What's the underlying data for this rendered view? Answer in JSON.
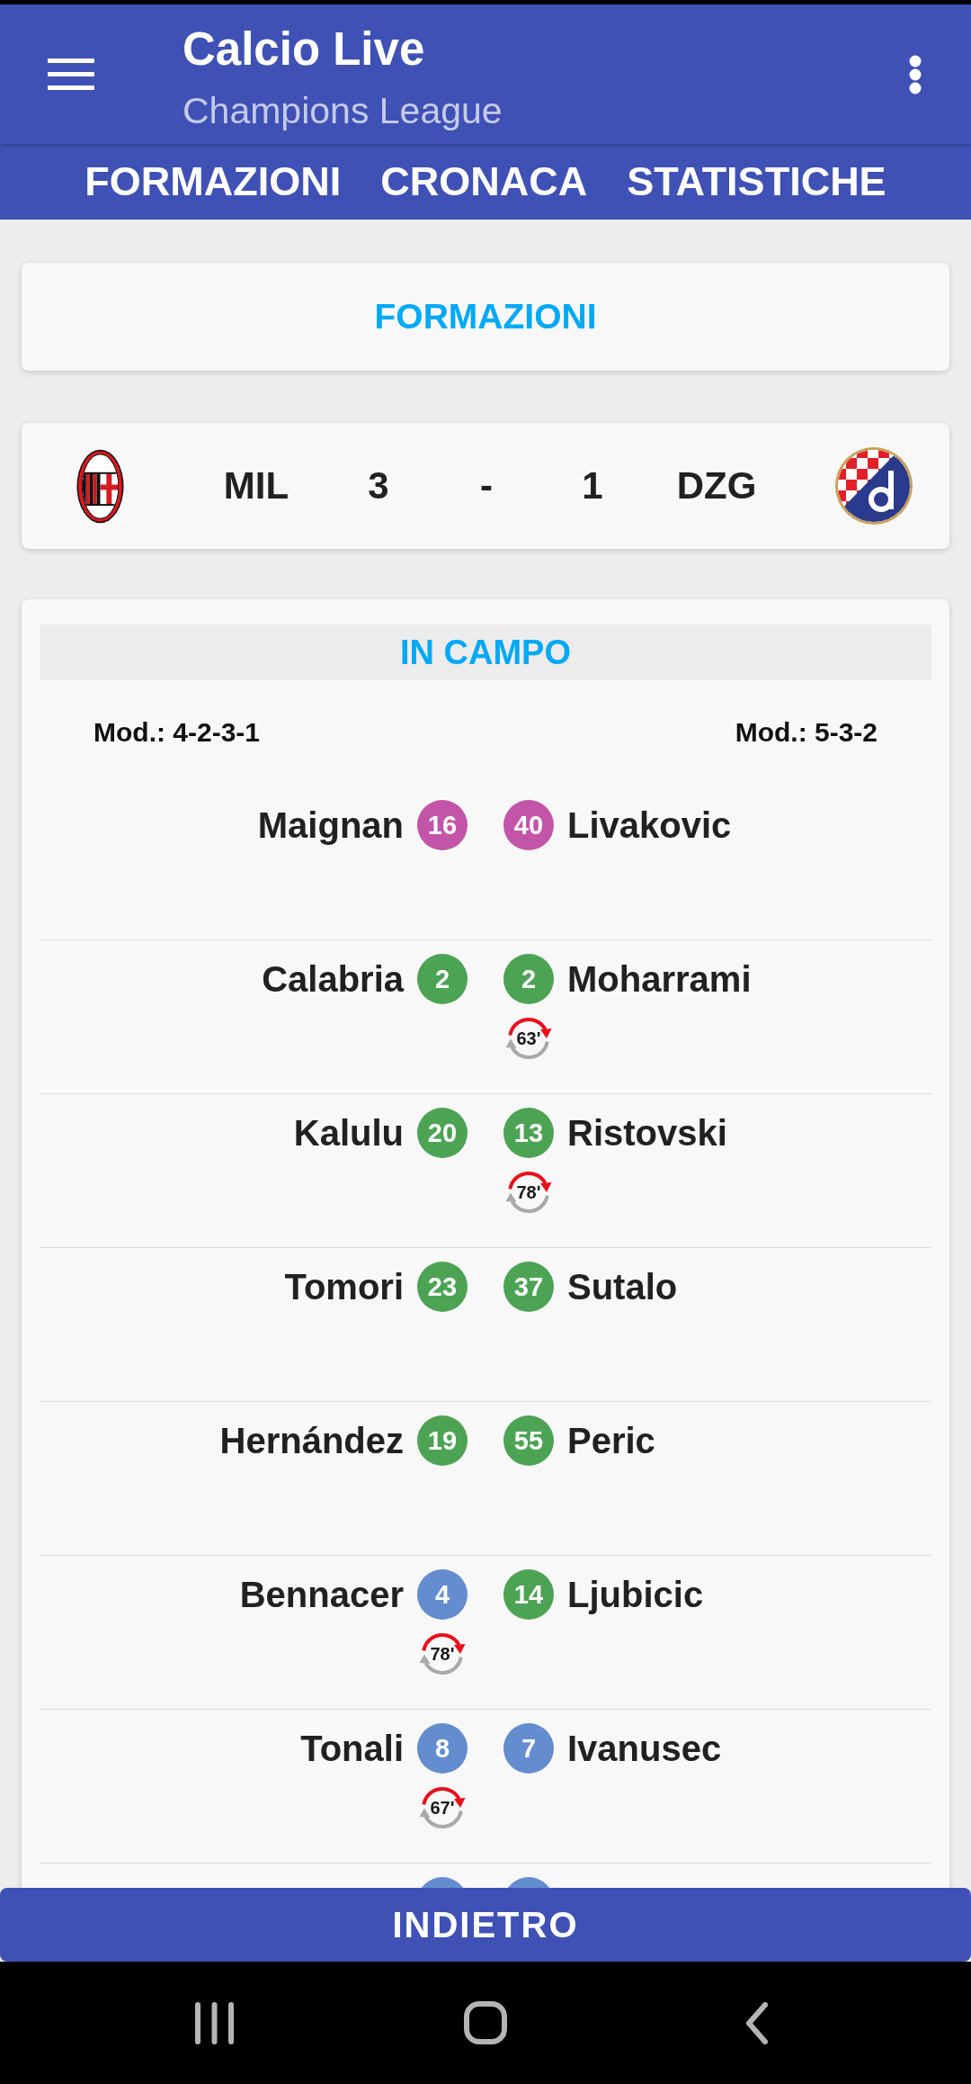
{
  "app_bar": {
    "title": "Calcio Live",
    "subtitle": "Champions League"
  },
  "tabs": [
    {
      "label": "FORMAZIONI"
    },
    {
      "label": "CRONACA"
    },
    {
      "label": "STATISTICHE"
    }
  ],
  "section_header": {
    "title": "FORMAZIONI"
  },
  "scoreboard": {
    "home_team": "MIL",
    "home_score": "3",
    "separator": "-",
    "away_score": "1",
    "away_team": "DZG"
  },
  "lineups": {
    "title": "IN CAMPO",
    "home_formation": "Mod.: 4-2-3-1",
    "away_formation": "Mod.: 5-3-2",
    "rows": [
      {
        "home": {
          "name": "Maignan",
          "number": "16",
          "color": "#c255a8"
        },
        "away": {
          "name": "Livakovic",
          "number": "40",
          "color": "#c255a8"
        }
      },
      {
        "home": {
          "name": "Calabria",
          "number": "2",
          "color": "#4ca354"
        },
        "away": {
          "name": "Moharrami",
          "number": "2",
          "color": "#4ca354",
          "substitution": "63'"
        }
      },
      {
        "home": {
          "name": "Kalulu",
          "number": "20",
          "color": "#4ca354"
        },
        "away": {
          "name": "Ristovski",
          "number": "13",
          "color": "#4ca354",
          "substitution": "78'"
        }
      },
      {
        "home": {
          "name": "Tomori",
          "number": "23",
          "color": "#4ca354"
        },
        "away": {
          "name": "Sutalo",
          "number": "37",
          "color": "#4ca354"
        }
      },
      {
        "home": {
          "name": "Hernández",
          "number": "19",
          "color": "#4ca354"
        },
        "away": {
          "name": "Peric",
          "number": "55",
          "color": "#4ca354"
        }
      },
      {
        "home": {
          "name": "Bennacer",
          "number": "4",
          "color": "#648dd0",
          "substitution": "78'"
        },
        "away": {
          "name": "Ljubicic",
          "number": "14",
          "color": "#4ca354"
        }
      },
      {
        "home": {
          "name": "Tonali",
          "number": "8",
          "color": "#648dd0",
          "substitution": "67'"
        },
        "away": {
          "name": "Ivanusec",
          "number": "7",
          "color": "#648dd0"
        }
      },
      {
        "home": {
          "color": "#648dd0"
        },
        "away": {
          "color": "#648dd0"
        }
      }
    ]
  },
  "back_button": {
    "label": "INDIETRO"
  }
}
